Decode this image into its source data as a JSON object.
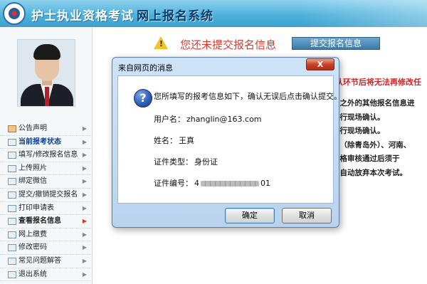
{
  "header": {
    "title_main": "护士执业资格考试",
    "title_sub": "网上报名系统"
  },
  "menu": {
    "items": [
      {
        "label": "公告声明"
      },
      {
        "label": "当前报考状态"
      },
      {
        "label": "填写/修改报名信息"
      },
      {
        "label": "上传照片"
      },
      {
        "label": "绑定微信"
      },
      {
        "label": "提交/撤销提交报名"
      },
      {
        "label": "打印申请表"
      },
      {
        "label": "查看报名信息"
      },
      {
        "label": "网上缴费"
      },
      {
        "label": "修改密码"
      },
      {
        "label": "常见问题解答"
      },
      {
        "label": "退出系统"
      }
    ]
  },
  "main": {
    "notice": "您还未提交报名信息",
    "submit_button": "提交报名信息",
    "red_note": "认环节后将无法再修改任",
    "info_lines": [
      "号之外的其他报名信息进",
      "进行现场确认。",
      "进行现场确认。",
      "东（除青岛外）、河南、",
      "资格审核通过后须于",
      "为自动放弃本次考试。"
    ]
  },
  "dialog": {
    "title": "来自网页的消息",
    "close_label": "X",
    "message": "您所填写的报考信息如下，确认无误后点击确认提交。",
    "username_label": "用户名：",
    "username_value": "zhanglin@163.com",
    "name_label": "姓名：",
    "name_value": "王真",
    "id_type_label": "证件类型：",
    "id_type_value": "身份证",
    "id_number_label": "证件编号：",
    "id_number_prefix": "4",
    "id_number_suffix": "01",
    "ok_label": "确定",
    "cancel_label": "取消"
  }
}
